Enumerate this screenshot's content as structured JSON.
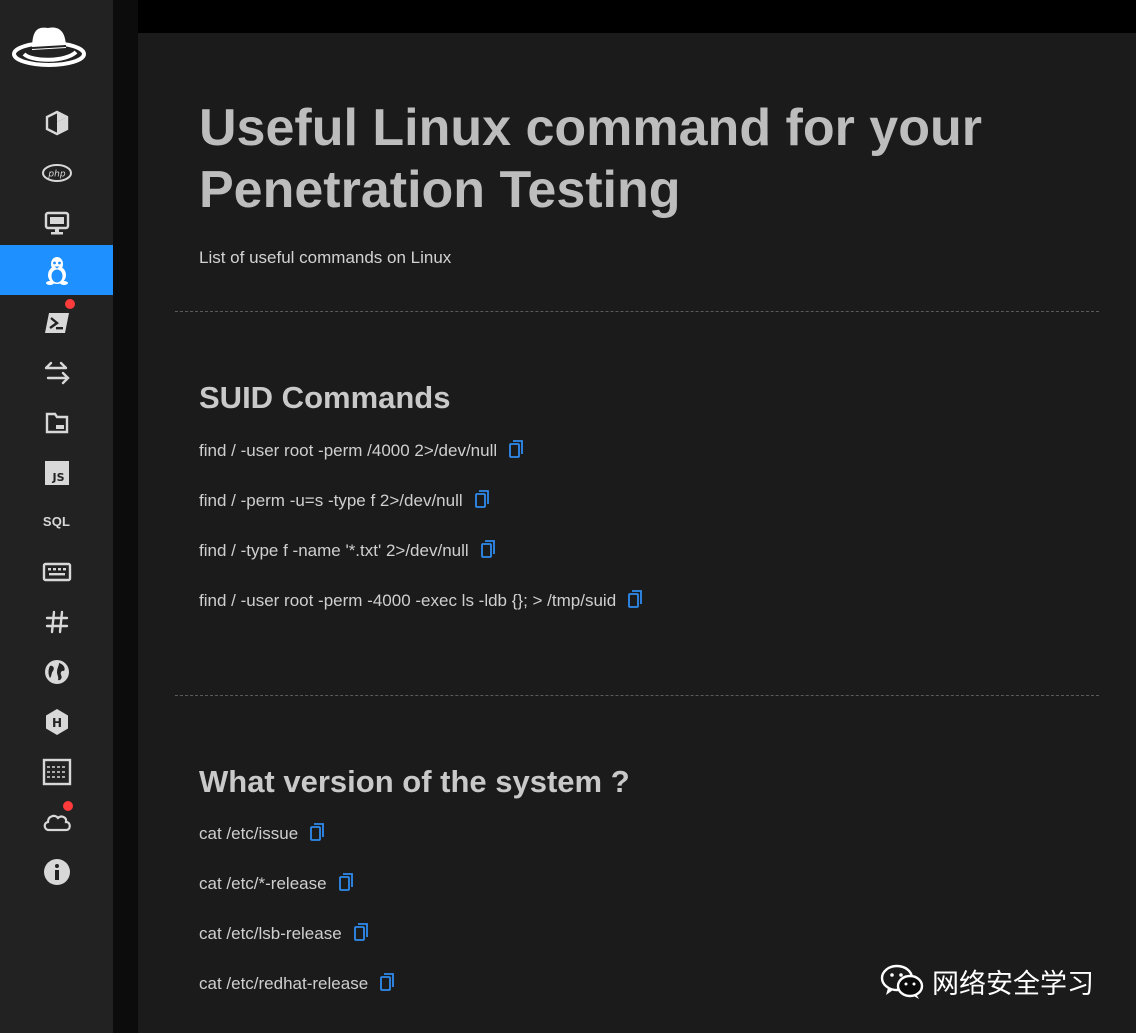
{
  "sidebar": {
    "items": [
      {
        "name": "cube"
      },
      {
        "name": "php"
      },
      {
        "name": "monitor"
      },
      {
        "name": "linux",
        "active": true
      },
      {
        "name": "powershell",
        "badge": true
      },
      {
        "name": "transfer"
      },
      {
        "name": "file"
      },
      {
        "name": "javascript",
        "text": "JS"
      },
      {
        "name": "sql",
        "text": "SQL"
      },
      {
        "name": "keyboard"
      },
      {
        "name": "hash"
      },
      {
        "name": "globe"
      },
      {
        "name": "hacktheboxhex"
      },
      {
        "name": "terminal-grid"
      },
      {
        "name": "cloud",
        "badge": true
      },
      {
        "name": "info"
      }
    ]
  },
  "page": {
    "title": "Useful Linux command for your Penetration Testing",
    "subtitle": "List of useful commands on Linux"
  },
  "sections": [
    {
      "title": "SUID Commands",
      "commands": [
        "find / -user root -perm /4000 2>/dev/null",
        "find / -perm -u=s -type f 2>/dev/null",
        "find / -type f -name '*.txt' 2>/dev/null",
        "find / -user root -perm -4000 -exec ls -ldb {}; > /tmp/suid"
      ]
    },
    {
      "title": "What version of the system ?",
      "commands": [
        "cat /etc/issue",
        "cat /etc/*-release",
        "cat /etc/lsb-release",
        "cat /etc/redhat-release"
      ]
    }
  ],
  "watermark": {
    "text": "网络安全学习"
  },
  "colors": {
    "accent": "#1e90ff",
    "badge": "#ff3b3b",
    "copy_icon": "#2f8cf0"
  }
}
